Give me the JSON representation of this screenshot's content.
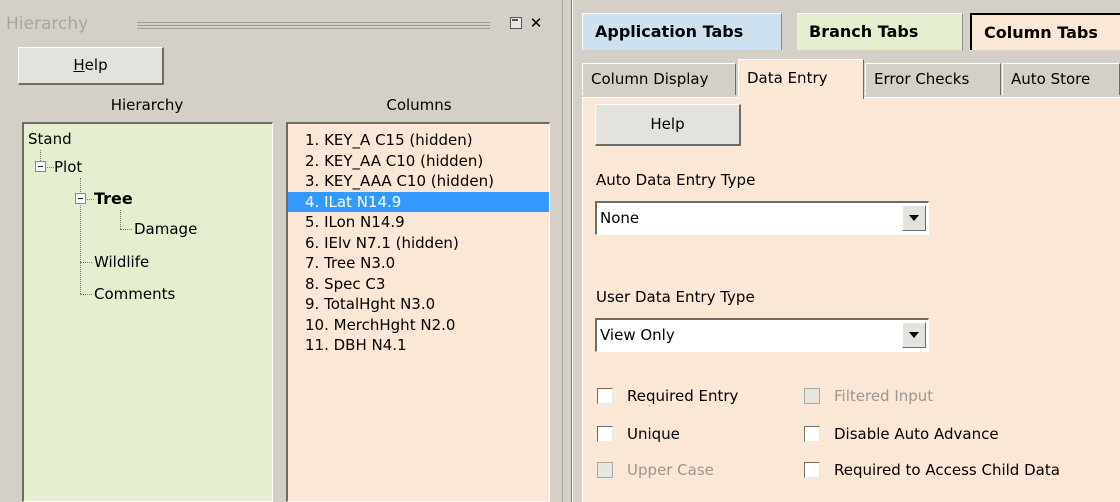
{
  "left_pane": {
    "title": "Hierarchy",
    "help_button": {
      "underlined_char": "H",
      "rest": "elp"
    },
    "hierarchy_header": "Hierarchy",
    "columns_header": "Columns",
    "tree": {
      "stand": "Stand",
      "plot": "Plot",
      "tree": "Tree",
      "damage": "Damage",
      "wildlife": "Wildlife",
      "comments": "Comments"
    },
    "columns": [
      "1. KEY_A C15 (hidden)",
      "2. KEY_AA C10 (hidden)",
      "3. KEY_AAA C10 (hidden)",
      "4. ILat N14.9",
      "5. ILon N14.9",
      "6. IElv N7.1 (hidden)",
      "7. Tree N3.0",
      "8. Spec C3",
      "9. TotalHght N3.0",
      "10. MerchHght N2.0",
      "11. DBH N4.1"
    ],
    "selected_column_index": 3
  },
  "right_pane": {
    "top_tabs": {
      "application": "Application Tabs",
      "branch": "Branch Tabs",
      "column": "Column Tabs"
    },
    "sub_tabs": {
      "display": "Column Display",
      "entry": "Data Entry",
      "errors": "Error Checks",
      "store": "Auto Store"
    },
    "help_button": "Help",
    "auto_entry": {
      "label": "Auto Data Entry Type",
      "value": "None"
    },
    "user_entry": {
      "label": "User Data Entry Type",
      "value": "View Only"
    },
    "checkboxes": {
      "required_entry": "Required Entry",
      "filtered_input": "Filtered Input",
      "unique": "Unique",
      "disable_auto_advance": "Disable Auto Advance",
      "upper_case": "Upper Case",
      "required_child": "Required to Access Child Data"
    }
  },
  "colors": {
    "panel": "#d4d0c8",
    "hierarchy_bg": "#e3efcf",
    "columns_bg": "#fbe7d5",
    "application_tab": "#cde1f1",
    "selection": "#3399ff"
  }
}
